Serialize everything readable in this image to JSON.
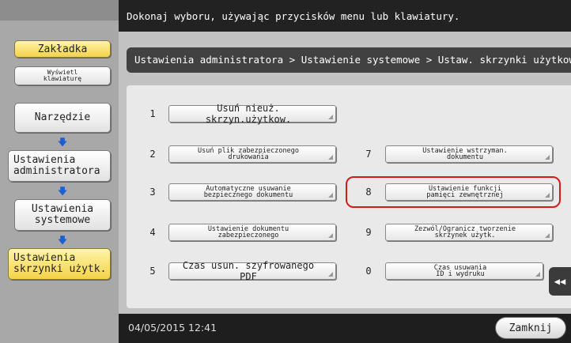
{
  "header": {
    "instruction": "Dokonaj wyboru, używając przycisków menu lub klawiatury."
  },
  "left": {
    "bookmark": "Zakładka",
    "keyboard": [
      "Wyświetl",
      "klawiaturę"
    ],
    "tool": "Narzędzie",
    "admin": [
      "Ustawienia",
      "administratora"
    ],
    "system": [
      "Ustawienia",
      "systemowe"
    ],
    "userbox": [
      "Ustawienia",
      "skrzynki użytk."
    ],
    "arrow": "🡇"
  },
  "breadcrumb": "Ustawienia administratora  > Ustawienie systemowe > Ustaw. skrzynki użytkow.",
  "items": [
    {
      "num": "1",
      "lines": [
        "Usuń nieuż. skrzyn.użytkow."
      ]
    },
    {
      "num": "2",
      "lines": [
        "Usuń plik zabezpieczonego",
        "drukowania"
      ]
    },
    {
      "num": "3",
      "lines": [
        "Automatyczne usuwanie",
        "bezpiecznego dokumentu"
      ]
    },
    {
      "num": "4",
      "lines": [
        "Ustawienie dokumentu",
        "zabezpieczonego"
      ]
    },
    {
      "num": "5",
      "lines": [
        "Czas usun. szyfrowanego PDF"
      ]
    },
    {
      "num": "7",
      "lines": [
        "Ustawienie wstrzyman.",
        "dokumentu"
      ]
    },
    {
      "num": "8",
      "lines": [
        "Ustawienie funkcji",
        "pamięci zewnętrznej"
      ]
    },
    {
      "num": "9",
      "lines": [
        "Zezwól/Ogranicz tworzenie",
        "skrzynek użytk."
      ]
    },
    {
      "num": "0",
      "lines": [
        "Czas usuwania",
        "ID i wydruku"
      ]
    }
  ],
  "footer": {
    "datetime": "04/05/2015  12:41",
    "close": "Zamknij"
  },
  "side_toggle": "◀◀",
  "colors": {
    "highlight": "#d61a1a",
    "arrow": "#1c5fd4",
    "selected": "#f4d24a"
  }
}
